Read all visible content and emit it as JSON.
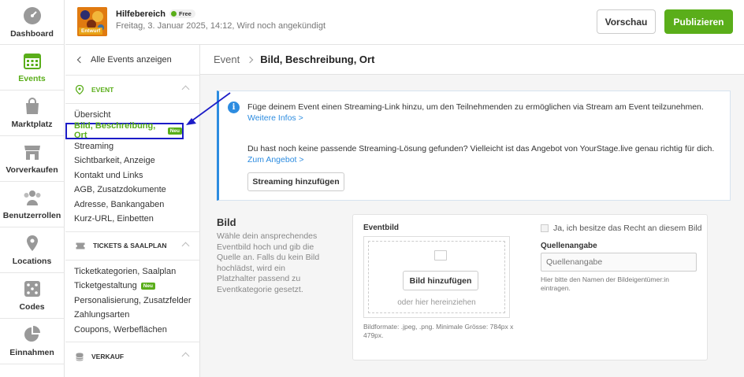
{
  "rail": [
    {
      "key": "dashboard",
      "label": "Dashboard",
      "icon": "dashboard-icon"
    },
    {
      "key": "events",
      "label": "Events",
      "icon": "calendar-icon",
      "active": true
    },
    {
      "key": "marktplatz",
      "label": "Marktplatz",
      "icon": "shopping-bag-icon"
    },
    {
      "key": "vorverkaufen",
      "label": "Vorverkaufen",
      "icon": "store-icon"
    },
    {
      "key": "benutzerrollen",
      "label": "Benutzerrollen",
      "icon": "users-icon"
    },
    {
      "key": "locations",
      "label": "Locations",
      "icon": "location-pin-icon"
    },
    {
      "key": "codes",
      "label": "Codes",
      "icon": "dice-icon"
    },
    {
      "key": "einnahmen",
      "label": "Einnahmen",
      "icon": "pie-chart-icon"
    }
  ],
  "topbar": {
    "event_title": "Hilfebereich",
    "free_badge": "Free",
    "thumb_badge": "Entwurf",
    "subtitle": "Freitag, 3. Januar 2025, 14:12, Wird noch angekündigt",
    "preview_label": "Vorschau",
    "publish_label": "Publizieren"
  },
  "sidebar": {
    "back_label": "Alle Events anzeigen",
    "event_section": "EVENT",
    "event_items": [
      "Übersicht",
      "Bild, Beschreibung, Ort",
      "Streaming",
      "Sichtbarkeit, Anzeige",
      "Kontakt und Links",
      "AGB, Zusatzdokumente",
      "Adresse, Bankangaben",
      "Kurz-URL, Einbetten"
    ],
    "tickets_section": "TICKETS & SAALPLAN",
    "ticket_items": [
      "Ticketkategorien, Saalplan",
      "Ticketgestaltung",
      "Personalisierung, Zusatzfelder",
      "Zahlungsarten",
      "Coupons, Werbeflächen"
    ],
    "sales_section": "VERKAUF",
    "new_badge": "Neu"
  },
  "breadcrumb": {
    "root": "Event",
    "current": "Bild, Beschreibung, Ort"
  },
  "info": {
    "text1": "Füge deinem Event einen Streaming-Link hinzu, um den Teilnehmenden zu ermöglichen via Stream am Event teilzunehmen.",
    "link1": "Weitere Infos >",
    "text2": "Du hast noch keine passende Streaming-Lösung gefunden? Vielleicht ist das Angebot von YourStage.live genau richtig für dich.",
    "link2": "Zum Angebot >",
    "button": "Streaming hinzufügen"
  },
  "bild": {
    "title": "Bild",
    "description": "Wähle dein ansprechendes Eventbild hoch und gib die Quelle an. Falls du kein Bild hochlädst, wird ein Platzhalter passend zu Eventkategorie gesetzt.",
    "eventbild_label": "Eventbild",
    "add_button": "Bild hinzufügen",
    "drag_text": "oder hier hereinziehen",
    "format_text": "Bildformate: .jpeg, .png. Minimale Grösse: 784px x 479px.",
    "rights_label": "Ja, ich besitze das Recht an diesem Bild",
    "source_label": "Quellenangabe",
    "source_placeholder": "Quellenangabe",
    "source_help": "Hier bitte den Namen der Bildeigentümer:in eintragen."
  },
  "colors": {
    "accent": "#5aae1a",
    "info": "#2d8ce0",
    "highlight": "#1c1cc7"
  }
}
